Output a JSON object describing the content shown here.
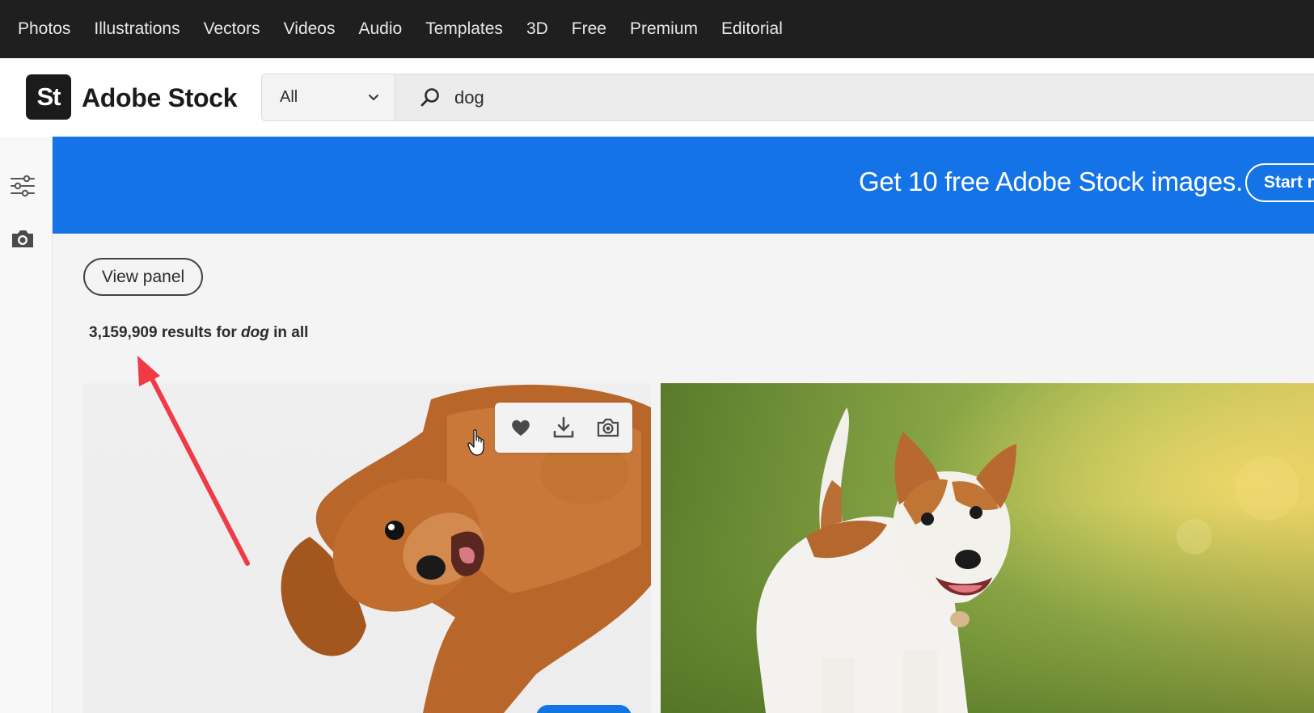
{
  "nav": {
    "items": [
      "Photos",
      "Illustrations",
      "Vectors",
      "Videos",
      "Audio",
      "Templates",
      "3D",
      "Free",
      "Premium",
      "Editorial"
    ]
  },
  "header": {
    "logo_mark": "St",
    "logo_text": "Adobe Stock",
    "scope": {
      "selected": "All",
      "icon": "chevron-down-icon"
    },
    "search": {
      "value": "dog",
      "icon": "search-icon"
    }
  },
  "rail": {
    "icons": [
      "filters-icon",
      "camera-icon"
    ]
  },
  "banner": {
    "text": "Get 10 free Adobe Stock images.",
    "button_label": "Start n",
    "color": "#1473e6"
  },
  "panel": {
    "view_panel_label": "View panel"
  },
  "results": {
    "count": "3,159,909",
    "prefix": "results for",
    "query": "dog",
    "suffix": "in all"
  },
  "image_toolbar": {
    "icons": [
      "heart-icon",
      "download-icon",
      "find-similar-icon"
    ]
  },
  "colors": {
    "topnav": "#1f1f1f",
    "accent": "#1473e6",
    "annotation_arrow": "#ee3b46"
  }
}
